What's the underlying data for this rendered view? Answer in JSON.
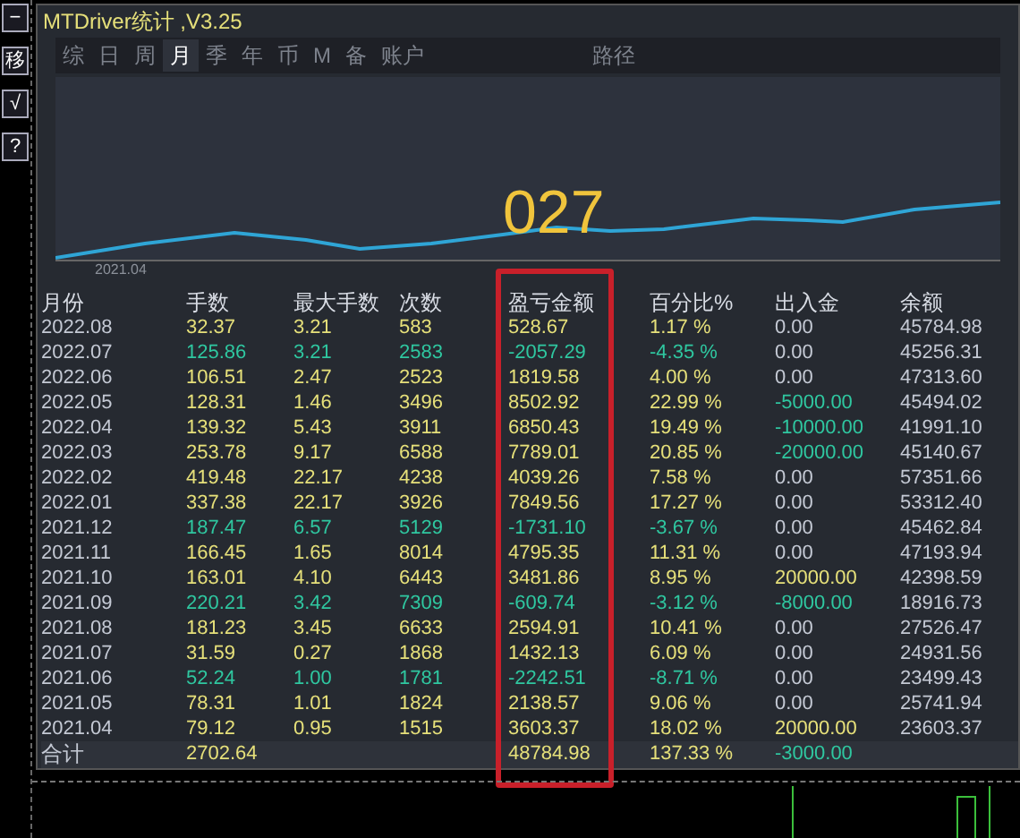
{
  "window": {
    "title": "MTDriver统计 ,V3.25"
  },
  "side_buttons": [
    "−",
    "移",
    "√",
    "?"
  ],
  "tabs": [
    {
      "label": "综",
      "selected": false
    },
    {
      "label": "日",
      "selected": false
    },
    {
      "label": "周",
      "selected": false
    },
    {
      "label": "月",
      "selected": true
    },
    {
      "label": "季",
      "selected": false
    },
    {
      "label": "年",
      "selected": false
    },
    {
      "label": "币",
      "selected": false
    },
    {
      "label": "M",
      "selected": false
    },
    {
      "label": "备",
      "selected": false
    },
    {
      "label": "账户",
      "selected": false
    },
    {
      "label": "路径",
      "selected": false
    }
  ],
  "chart": {
    "overlay_text": "027",
    "start_label": "2021.04"
  },
  "table": {
    "columns": [
      "月份",
      "手数",
      "最大手数",
      "次数",
      "盈亏金额",
      "百分比%",
      "出入金",
      "余额"
    ],
    "rows": [
      {
        "loss": false,
        "cells": [
          "2022.08",
          "32.37",
          "3.21",
          "583",
          "528.67",
          "1.17 %"
        ],
        "flow": {
          "value": "0.00",
          "color": "#c4c9d4"
        },
        "balance": "45784.98"
      },
      {
        "loss": true,
        "cells": [
          "2022.07",
          "125.86",
          "3.21",
          "2583",
          "-2057.29",
          "-4.35 %"
        ],
        "flow": {
          "value": "0.00",
          "color": "#c4c9d4"
        },
        "balance": "45256.31"
      },
      {
        "loss": false,
        "cells": [
          "2022.06",
          "106.51",
          "2.47",
          "2523",
          "1819.58",
          "4.00 %"
        ],
        "flow": {
          "value": "0.00",
          "color": "#c4c9d4"
        },
        "balance": "47313.60"
      },
      {
        "loss": false,
        "cells": [
          "2022.05",
          "128.31",
          "1.46",
          "3496",
          "8502.92",
          "22.99 %"
        ],
        "flow": {
          "value": "-5000.00",
          "color": "#2fc7a0"
        },
        "balance": "45494.02"
      },
      {
        "loss": false,
        "cells": [
          "2022.04",
          "139.32",
          "5.43",
          "3911",
          "6850.43",
          "19.49 %"
        ],
        "flow": {
          "value": "-10000.00",
          "color": "#2fc7a0"
        },
        "balance": "41991.10"
      },
      {
        "loss": false,
        "cells": [
          "2022.03",
          "253.78",
          "9.17",
          "6588",
          "7789.01",
          "20.85 %"
        ],
        "flow": {
          "value": "-20000.00",
          "color": "#2fc7a0"
        },
        "balance": "45140.67"
      },
      {
        "loss": false,
        "cells": [
          "2022.02",
          "419.48",
          "22.17",
          "4238",
          "4039.26",
          "7.58 %"
        ],
        "flow": {
          "value": "0.00",
          "color": "#c4c9d4"
        },
        "balance": "57351.66"
      },
      {
        "loss": false,
        "cells": [
          "2022.01",
          "337.38",
          "22.17",
          "3926",
          "7849.56",
          "17.27 %"
        ],
        "flow": {
          "value": "0.00",
          "color": "#c4c9d4"
        },
        "balance": "53312.40"
      },
      {
        "loss": true,
        "cells": [
          "2021.12",
          "187.47",
          "6.57",
          "5129",
          "-1731.10",
          "-3.67 %"
        ],
        "flow": {
          "value": "0.00",
          "color": "#c4c9d4"
        },
        "balance": "45462.84"
      },
      {
        "loss": false,
        "cells": [
          "2021.11",
          "166.45",
          "1.65",
          "8014",
          "4795.35",
          "11.31 %"
        ],
        "flow": {
          "value": "0.00",
          "color": "#c4c9d4"
        },
        "balance": "47193.94"
      },
      {
        "loss": false,
        "cells": [
          "2021.10",
          "163.01",
          "4.10",
          "6443",
          "3481.86",
          "8.95 %"
        ],
        "flow": {
          "value": "20000.00",
          "color": "#e6e07a"
        },
        "balance": "42398.59"
      },
      {
        "loss": true,
        "cells": [
          "2021.09",
          "220.21",
          "3.42",
          "7309",
          "-609.74",
          "-3.12 %"
        ],
        "flow": {
          "value": "-8000.00",
          "color": "#2fc7a0"
        },
        "balance": "18916.73"
      },
      {
        "loss": false,
        "cells": [
          "2021.08",
          "181.23",
          "3.45",
          "6633",
          "2594.91",
          "10.41 %"
        ],
        "flow": {
          "value": "0.00",
          "color": "#c4c9d4"
        },
        "balance": "27526.47"
      },
      {
        "loss": false,
        "cells": [
          "2021.07",
          "31.59",
          "0.27",
          "1868",
          "1432.13",
          "6.09 %"
        ],
        "flow": {
          "value": "0.00",
          "color": "#c4c9d4"
        },
        "balance": "24931.56"
      },
      {
        "loss": true,
        "cells": [
          "2021.06",
          "52.24",
          "1.00",
          "1781",
          "-2242.51",
          "-8.71 %"
        ],
        "flow": {
          "value": "0.00",
          "color": "#c4c9d4"
        },
        "balance": "23499.43"
      },
      {
        "loss": false,
        "cells": [
          "2021.05",
          "78.31",
          "1.01",
          "1824",
          "2138.57",
          "9.06 %"
        ],
        "flow": {
          "value": "0.00",
          "color": "#c4c9d4"
        },
        "balance": "25741.94"
      },
      {
        "loss": false,
        "cells": [
          "2021.04",
          "79.12",
          "0.95",
          "1515",
          "3603.37",
          "18.02 %"
        ],
        "flow": {
          "value": "20000.00",
          "color": "#e6e07a"
        },
        "balance": "23603.37"
      }
    ],
    "total": {
      "label": "合计",
      "lots": "2702.64",
      "pnl": "48784.98",
      "percent": "137.33 %",
      "flow": {
        "value": "-3000.00",
        "color": "#2fc7a0"
      }
    }
  }
}
